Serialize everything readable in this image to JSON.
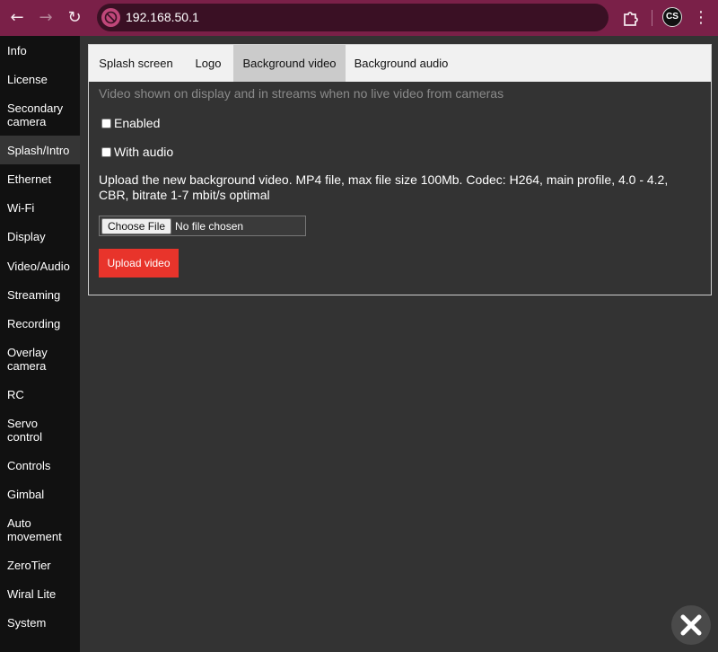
{
  "browser": {
    "url": "192.168.50.1",
    "profile_initials": "CS",
    "accent": "#7a2048"
  },
  "sidebar": {
    "items": [
      {
        "label": "Info"
      },
      {
        "label": "License"
      },
      {
        "label": "Secondary camera"
      },
      {
        "label": "Splash/Intro",
        "active": true
      },
      {
        "label": "Ethernet"
      },
      {
        "label": "Wi-Fi"
      },
      {
        "label": "Display"
      },
      {
        "label": "Video/Audio"
      },
      {
        "label": "Streaming"
      },
      {
        "label": "Recording"
      },
      {
        "label": "Overlay camera"
      },
      {
        "label": "RC"
      },
      {
        "label": "Servo control"
      },
      {
        "label": "Controls"
      },
      {
        "label": "Gimbal"
      },
      {
        "label": "Auto movement"
      },
      {
        "label": "ZeroTier"
      },
      {
        "label": "Wiral Lite"
      },
      {
        "label": "System"
      }
    ]
  },
  "tabs": [
    {
      "label": "Splash screen"
    },
    {
      "label": "Logo"
    },
    {
      "label": "Background video",
      "active": true
    },
    {
      "label": "Background audio"
    }
  ],
  "content": {
    "hint": "Video shown on display and in streams when no live video from cameras",
    "enabled_label": "Enabled",
    "enabled_checked": false,
    "with_audio_label": "With audio",
    "with_audio_checked": false,
    "upload_text": "Upload the new background video. MP4 file, max file size 100Mb. Codec: H264, main profile, 4.0 - 4.2, CBR, bitrate 1-7 mbit/s optimal",
    "choose_file_label": "Choose File",
    "file_status": "No file chosen",
    "upload_button_label": "Upload video",
    "upload_button_color": "#e8342b"
  }
}
